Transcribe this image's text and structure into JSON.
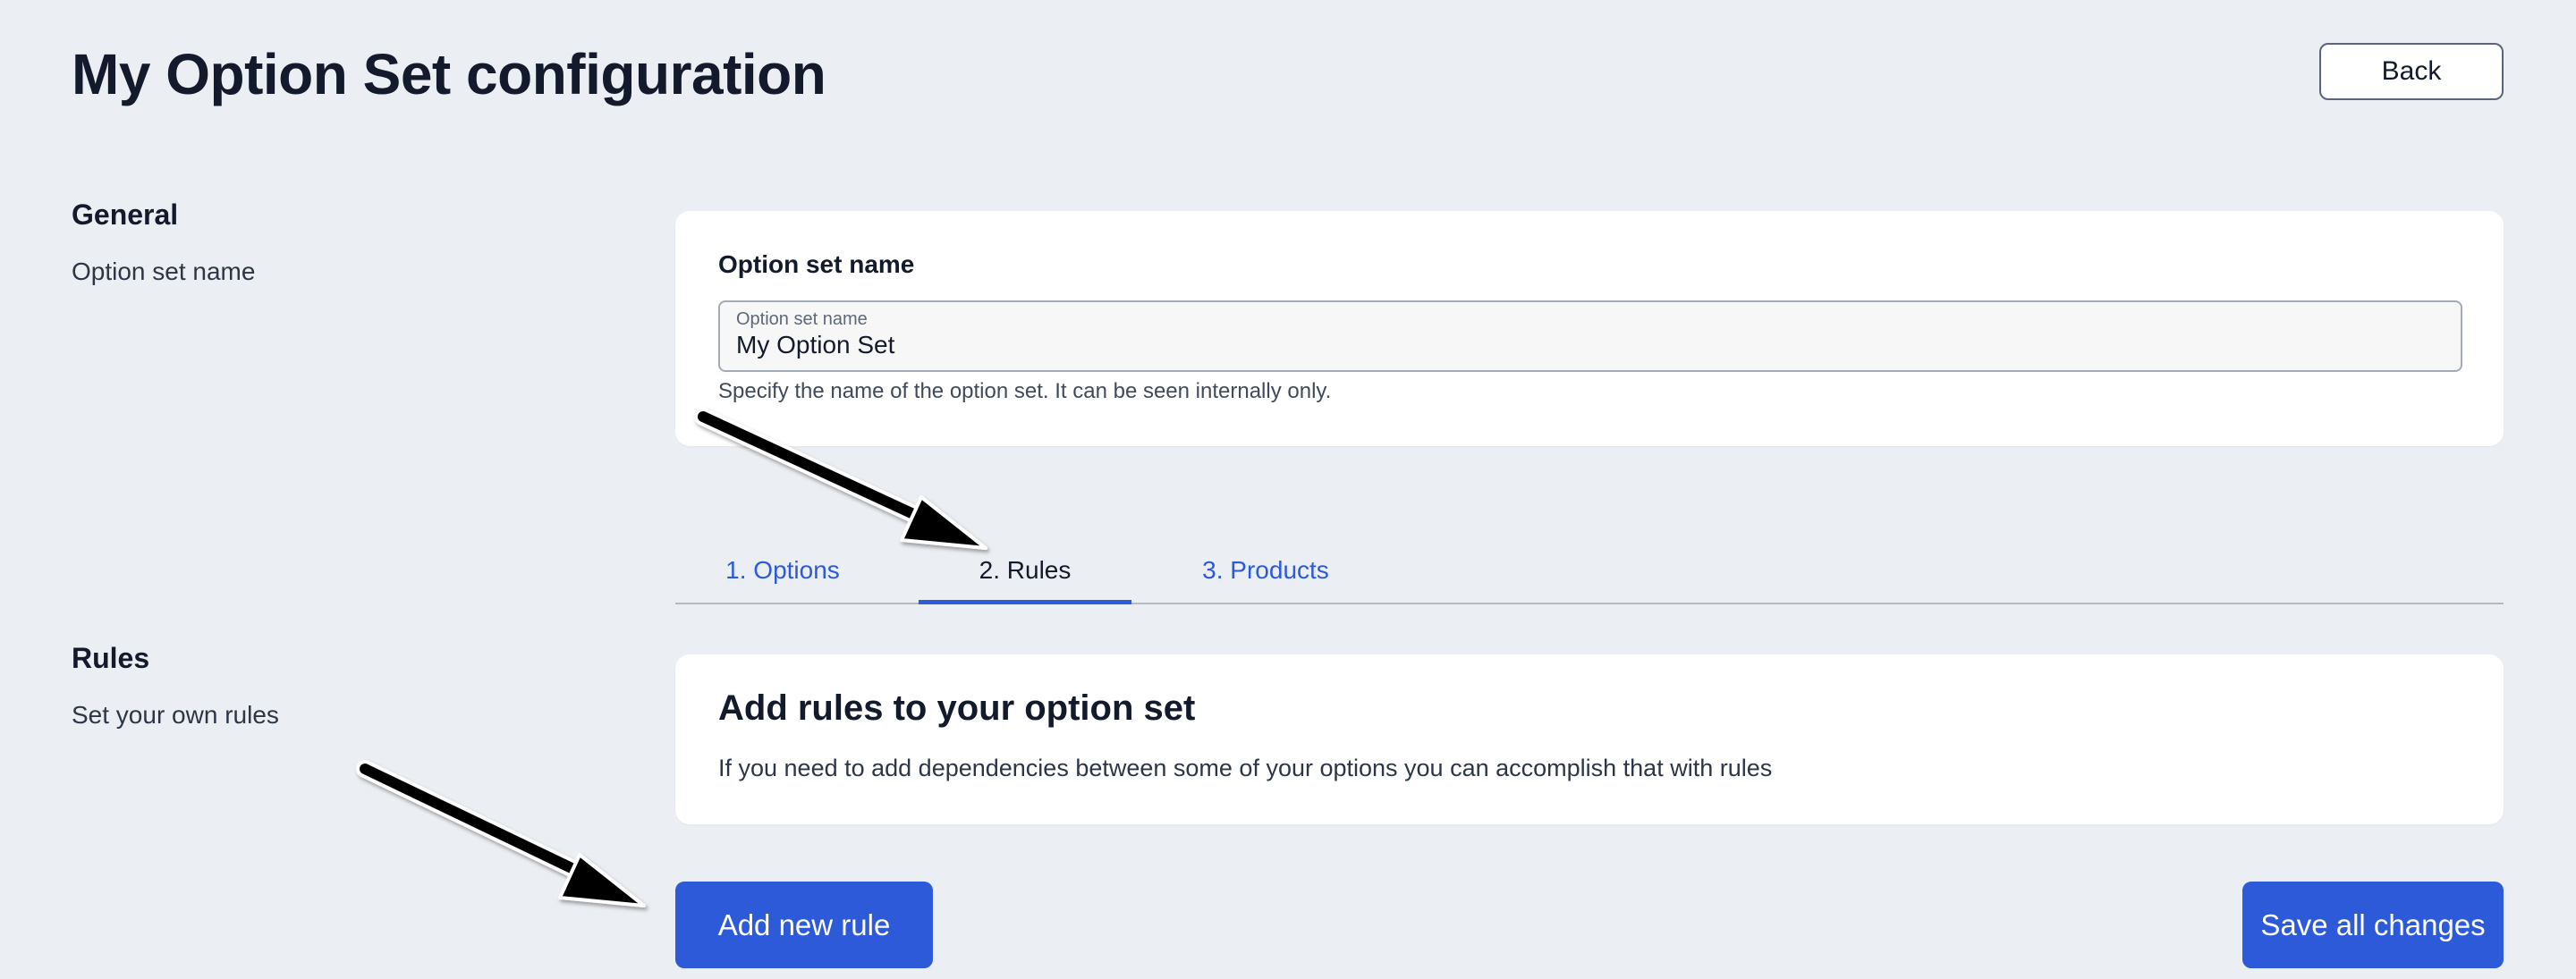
{
  "header": {
    "title": "My Option Set configuration",
    "back_label": "Back"
  },
  "general_section": {
    "title": "General",
    "description": "Option set name",
    "card": {
      "heading": "Option set name",
      "field_label": "Option set name",
      "field_value": "My Option Set",
      "help_text": "Specify the name of the option set. It can be seen internally only."
    }
  },
  "tabs": [
    {
      "label": "1. Options",
      "active": false
    },
    {
      "label": "2. Rules",
      "active": true
    },
    {
      "label": "3. Products",
      "active": false
    }
  ],
  "rules_section": {
    "title": "Rules",
    "description": "Set your own rules",
    "card": {
      "heading": "Add rules to your option set",
      "text": "If you need to add dependencies between some of your options you can accomplish that with rules"
    }
  },
  "actions": {
    "add_rule_label": "Add new rule",
    "save_label": "Save all changes"
  },
  "colors": {
    "background": "#ebeef2",
    "primary": "#2c5ad9",
    "text": "#121a2b"
  },
  "icons": [
    "annotation-arrow-icon"
  ]
}
